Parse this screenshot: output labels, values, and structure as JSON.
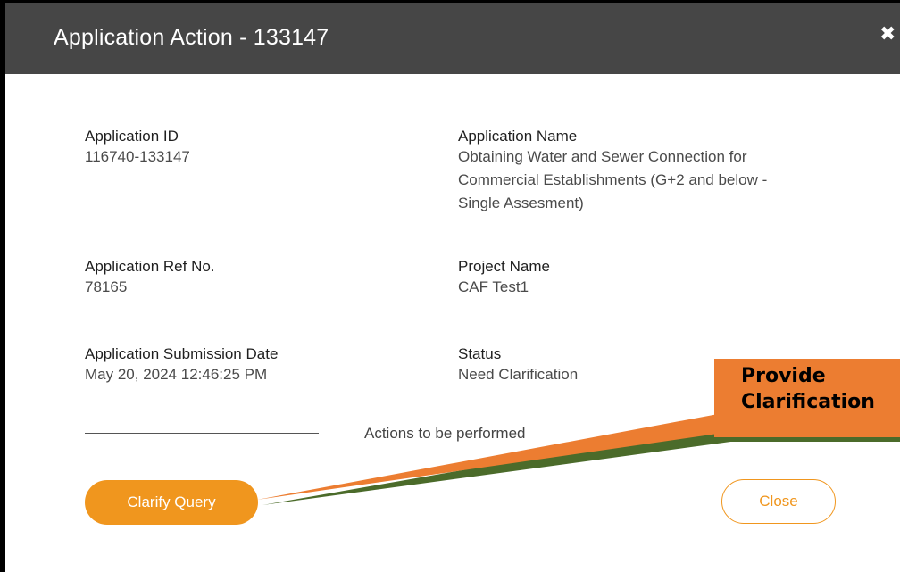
{
  "dialog": {
    "title": "Application Action - 133147",
    "close_icon": "close-x-icon"
  },
  "fields": {
    "application_id": {
      "label": "Application ID",
      "value": "116740-133147"
    },
    "application_name": {
      "label": "Application Name",
      "lines": [
        "Obtaining Water and Sewer Connection for",
        "Commercial Establishments (G+2 and below -",
        "Single Assesment)"
      ]
    },
    "application_ref": {
      "label": "Application Ref No.",
      "value": "78165"
    },
    "project_name": {
      "label": "Project Name",
      "value": "CAF Test1"
    },
    "submission_date": {
      "label": "Application Submission Date",
      "value": "May 20, 2024 12:46:25 PM"
    },
    "status": {
      "label": "Status",
      "value": "Need Clarification"
    }
  },
  "actions": {
    "heading": "Actions to be performed",
    "clarify_label": "Clarify Query",
    "close_label": "Close"
  },
  "callout": {
    "line1": "Provide",
    "line2": "Clarification"
  },
  "colors": {
    "header_bg": "#464646",
    "accent": "#f0961e",
    "callout_bg": "#ec7d31",
    "callout_shadow": "#4b6b2a"
  }
}
